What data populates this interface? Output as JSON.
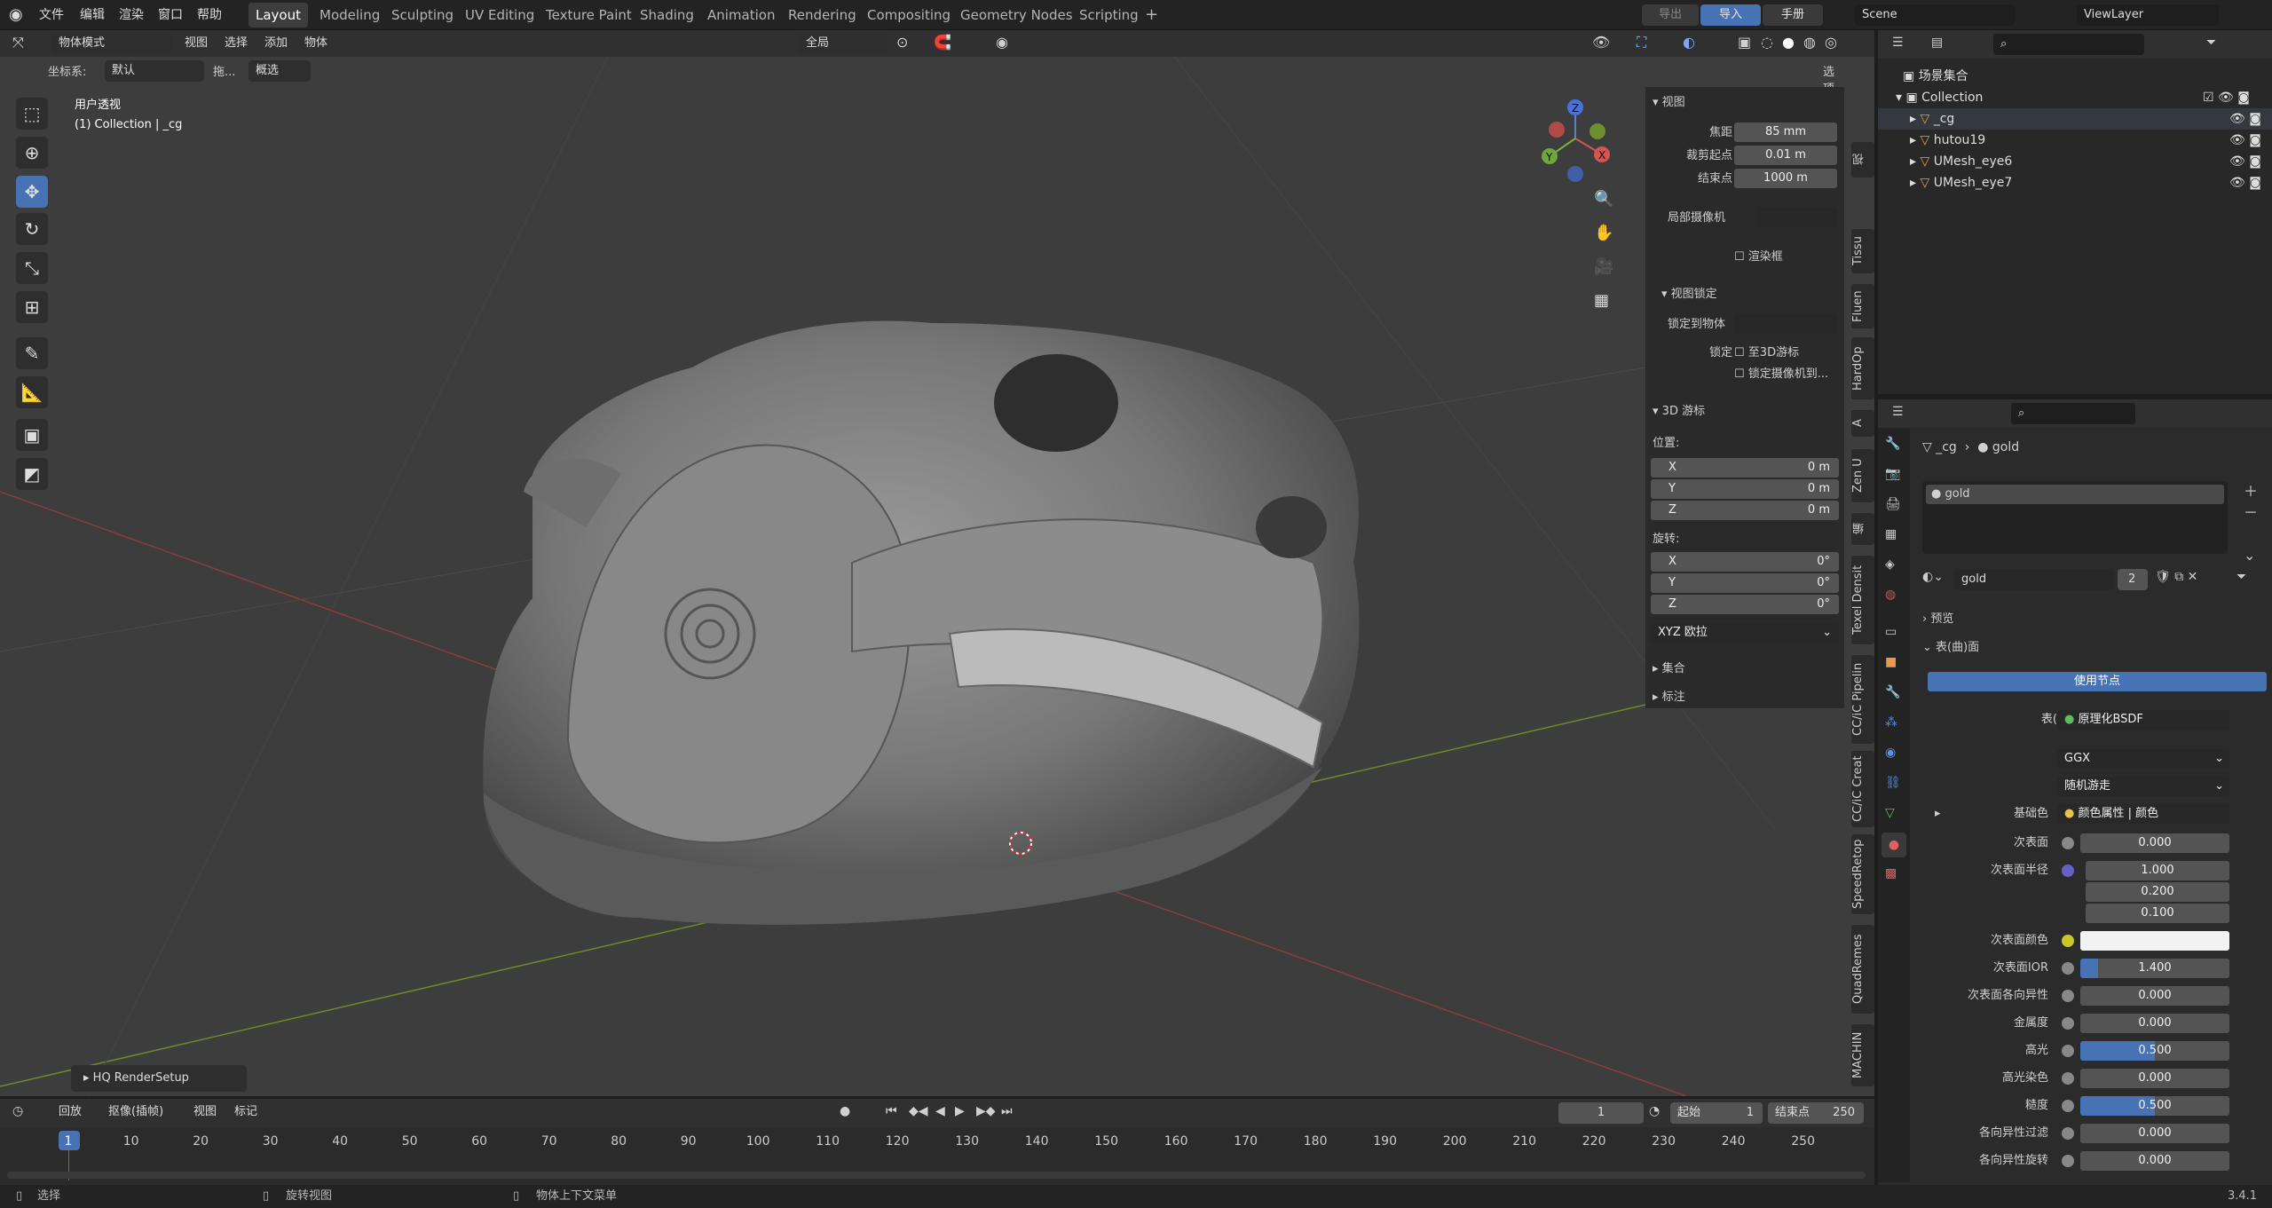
{
  "topbar": {
    "menus": [
      "文件",
      "编辑",
      "渲染",
      "窗口",
      "帮助"
    ],
    "workspaces": [
      "Layout",
      "Modeling",
      "Sculpting",
      "UV Editing",
      "Texture Paint",
      "Shading",
      "Animation",
      "Rendering",
      "Compositing",
      "Geometry Nodes",
      "Scripting"
    ],
    "active_workspace": "Layout",
    "add_tab": "+",
    "export_label": "导出",
    "import_label": "导入",
    "manual_label": "手册",
    "scene": "Scene",
    "view_layer": "ViewLayer"
  },
  "viewport_header": {
    "mode": "物体模式",
    "menus": [
      "视图",
      "选择",
      "添加",
      "物体"
    ],
    "transform": "全局",
    "options": "选项"
  },
  "viewport_header2": {
    "coord_label": "坐标系:",
    "coord_value": "默认",
    "drag_label": "拖...",
    "select_value": "概选"
  },
  "viewport_info": {
    "line1": "用户透视",
    "line2": "(1) Collection | _cg"
  },
  "gizmo": {
    "x": "X",
    "y": "Y",
    "z": "Z"
  },
  "npanel": {
    "view_header": "视图",
    "focal_label": "焦距",
    "focal_value": "85 mm",
    "clip_start_label": "裁剪起点",
    "clip_start_value": "0.01 m",
    "clip_end_label": "结束点",
    "clip_end_value": "1000 m",
    "local_camera_label": "局部摄像机",
    "render_region_label": "渲染框",
    "view_lock_header": "视图锁定",
    "lock_object_label": "锁定到物体",
    "lock_label": "锁定",
    "lock_3d_cursor": "至3D游标",
    "lock_camera": "锁定摄像机到...",
    "cursor_header": "3D 游标",
    "location_label": "位置:",
    "loc": [
      {
        "axis": "X",
        "value": "0 m"
      },
      {
        "axis": "Y",
        "value": "0 m"
      },
      {
        "axis": "Z",
        "value": "0 m"
      }
    ],
    "rotation_label": "旋转:",
    "rot": [
      {
        "axis": "X",
        "value": "0°"
      },
      {
        "axis": "Y",
        "value": "0°"
      },
      {
        "axis": "Z",
        "value": "0°"
      }
    ],
    "rot_mode": "XYZ 欧拉",
    "collection_header": "集合",
    "annotation_header": "标注"
  },
  "side_tabs": [
    "视",
    "Tissu",
    "Fluen",
    "HardOp",
    "A",
    "Zen U",
    "编",
    "Texel Densit",
    "CC/iC Pipelin",
    "CC/iC Creat",
    "SpeedRetop",
    "QuadRemes",
    "MACHIN"
  ],
  "outliner": {
    "scene_collection": "场景集合",
    "collection": "Collection",
    "objects": [
      "_cg",
      "hutou19",
      "UMesh_eye6",
      "UMesh_eye7"
    ]
  },
  "properties": {
    "breadcrumb_object": "_cg",
    "breadcrumb_material": "gold",
    "slot_name": "gold",
    "material_name": "gold",
    "user_count": "2",
    "preview_header": "预览",
    "surface_header": "表(曲)面",
    "use_nodes": "使用节点",
    "surface_label": "表(曲)面",
    "surface_value": "原理化BSDF",
    "distribution": "GGX",
    "subsurface_method": "随机游走",
    "base_color_label": "基础色",
    "base_color_value": "颜色属性 | 颜色",
    "rows": [
      {
        "label": "次表面",
        "value": "0.000"
      },
      {
        "label": "次表面半径",
        "value": "1.000"
      },
      {
        "label": "",
        "value": "0.200"
      },
      {
        "label": "",
        "value": "0.100"
      },
      {
        "label": "次表面颜色",
        "value": ""
      },
      {
        "label": "次表面IOR",
        "value": "1.400"
      },
      {
        "label": "次表面各向异性",
        "value": "0.000"
      },
      {
        "label": "金属度",
        "value": "0.000"
      },
      {
        "label": "高光",
        "value": "0.500"
      },
      {
        "label": "高光染色",
        "value": "0.000"
      },
      {
        "label": "糙度",
        "value": "0.500"
      },
      {
        "label": "各向异性过滤",
        "value": "0.000"
      },
      {
        "label": "各向异性旋转",
        "value": "0.000"
      }
    ]
  },
  "hq_panel": "HQ RenderSetup",
  "timeline": {
    "menus": [
      "回放",
      "抠像(插帧)",
      "视图",
      "标记"
    ],
    "current_frame": "1",
    "start_label": "起始",
    "start_value": "1",
    "end_label": "结束点",
    "end_value": "250",
    "ticks": [
      "1",
      "10",
      "20",
      "30",
      "40",
      "50",
      "60",
      "70",
      "80",
      "90",
      "100",
      "110",
      "120",
      "130",
      "140",
      "150",
      "160",
      "170",
      "180",
      "190",
      "200",
      "210",
      "220",
      "230",
      "240",
      "250"
    ]
  },
  "statusbar": {
    "select": "选择",
    "rotate": "旋转视图",
    "context": "物体上下文菜单",
    "version": "3.4.1"
  },
  "colors": {
    "accent": "#4772b3",
    "viewport": "#3d3d3d",
    "panel": "#2b2b2b"
  }
}
